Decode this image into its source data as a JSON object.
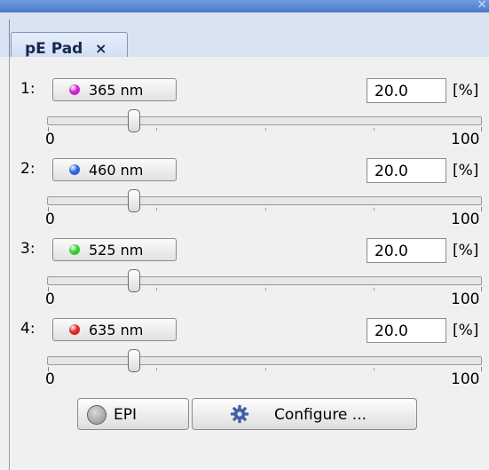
{
  "window": {
    "close_glyph": "×"
  },
  "tab": {
    "title": "pE Pad",
    "close": "×"
  },
  "channels": [
    {
      "index": "1:",
      "wavelength": "365 nm",
      "color": "#cc22cc",
      "value": "20.0",
      "unit": "[%]",
      "min": "0",
      "max": "100",
      "level": 0.2
    },
    {
      "index": "2:",
      "wavelength": "460 nm",
      "color": "#2a63e0",
      "value": "20.0",
      "unit": "[%]",
      "min": "0",
      "max": "100",
      "level": 0.2
    },
    {
      "index": "3:",
      "wavelength": "525 nm",
      "color": "#33cc33",
      "value": "20.0",
      "unit": "[%]",
      "min": "0",
      "max": "100",
      "level": 0.2
    },
    {
      "index": "4:",
      "wavelength": "635 nm",
      "color": "#e12222",
      "value": "20.0",
      "unit": "[%]",
      "min": "0",
      "max": "100",
      "level": 0.2
    }
  ],
  "buttons": {
    "epi": "EPI",
    "configure": "Configure ..."
  },
  "icons": {
    "led": "led-indicator-icon",
    "gear": "gear-icon"
  }
}
